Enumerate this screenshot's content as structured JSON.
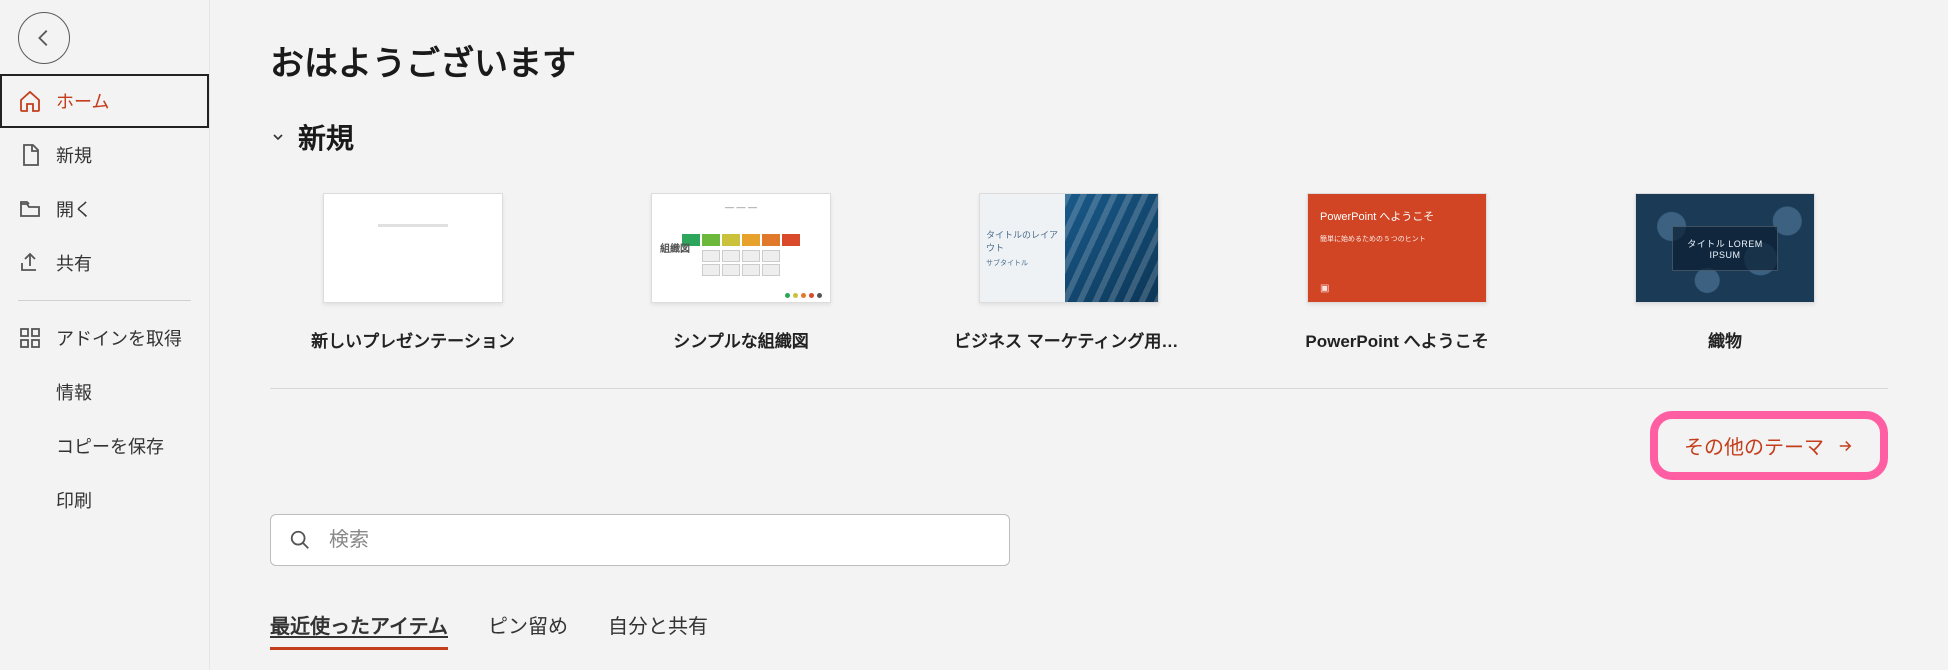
{
  "greeting": "おはようございます",
  "sidebar": {
    "items": [
      {
        "label": "ホーム"
      },
      {
        "label": "新規"
      },
      {
        "label": "開く"
      },
      {
        "label": "共有"
      },
      {
        "label": "アドインを取得"
      }
    ],
    "sub_items": [
      {
        "label": "情報"
      },
      {
        "label": "コピーを保存"
      },
      {
        "label": "印刷"
      }
    ]
  },
  "new_section": {
    "title": "新規",
    "templates": [
      {
        "label": "新しいプレゼンテーション"
      },
      {
        "label": "シンプルな組織図"
      },
      {
        "label": "ビジネス マーケティング用ガラ…"
      },
      {
        "label": "PowerPoint へようこそ"
      },
      {
        "label": "織物"
      }
    ],
    "more_label": "その他のテーマ"
  },
  "thumbs": {
    "org_label": "組織図",
    "biz_title": "タイトルのレイアウト",
    "biz_sub": "サブタイトル",
    "welcome_title": "PowerPoint へようこそ",
    "welcome_sub": "簡単に始めるための 5 つのヒント",
    "fabric_title": "タイトル LOREM",
    "fabric_sub": "IPSUM"
  },
  "search": {
    "placeholder": "検索"
  },
  "tabs": {
    "recent": "最近使ったアイテム",
    "pinned": "ピン留め",
    "shared": "自分と共有"
  }
}
